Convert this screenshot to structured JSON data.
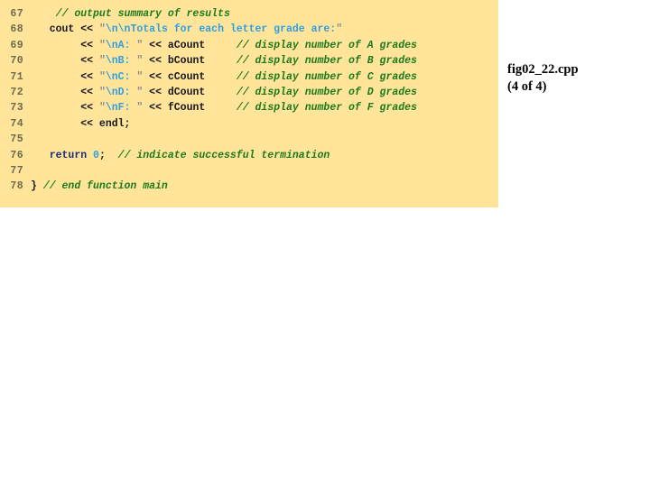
{
  "code_panel": {
    "background_color": "#ffe49a",
    "lineno_color": "#6e6a4c",
    "language": "cpp",
    "first_line_number": 67,
    "last_line_number": 78,
    "lines": [
      {
        "number": "67",
        "text": "    // output summary of results",
        "tokens": [
          {
            "t": "    ",
            "c": "plain"
          },
          {
            "t": "// output summary of results",
            "c": "comment"
          }
        ]
      },
      {
        "number": "68",
        "text": "   cout << \"\\n\\nTotals for each letter grade are:\"",
        "tokens": [
          {
            "t": "   ",
            "c": "plain"
          },
          {
            "t": "cout",
            "c": "plain"
          },
          {
            "t": " << ",
            "c": "plain"
          },
          {
            "t": "\"",
            "c": "quote"
          },
          {
            "t": "\\n\\nTotals for each letter grade are:",
            "c": "str"
          },
          {
            "t": "\"",
            "c": "quote"
          }
        ]
      },
      {
        "number": "69",
        "text": "        << \"\\nA: \" << aCount     // display number of A grades",
        "tokens": [
          {
            "t": "        ",
            "c": "plain"
          },
          {
            "t": "<< ",
            "c": "plain"
          },
          {
            "t": "\"",
            "c": "quote"
          },
          {
            "t": "\\nA: ",
            "c": "str"
          },
          {
            "t": "\"",
            "c": "quote"
          },
          {
            "t": " << ",
            "c": "plain"
          },
          {
            "t": "aCount",
            "c": "plain"
          },
          {
            "t": "     ",
            "c": "plain"
          },
          {
            "t": "// display number of A grades",
            "c": "comment"
          }
        ]
      },
      {
        "number": "70",
        "text": "        << \"\\nB: \" << bCount     // display number of B grades",
        "tokens": [
          {
            "t": "        ",
            "c": "plain"
          },
          {
            "t": "<< ",
            "c": "plain"
          },
          {
            "t": "\"",
            "c": "quote"
          },
          {
            "t": "\\nB: ",
            "c": "str"
          },
          {
            "t": "\"",
            "c": "quote"
          },
          {
            "t": " << ",
            "c": "plain"
          },
          {
            "t": "bCount",
            "c": "plain"
          },
          {
            "t": "     ",
            "c": "plain"
          },
          {
            "t": "// display number of B grades",
            "c": "comment"
          }
        ]
      },
      {
        "number": "71",
        "text": "        << \"\\nC: \" << cCount     // display number of C grades",
        "tokens": [
          {
            "t": "        ",
            "c": "plain"
          },
          {
            "t": "<< ",
            "c": "plain"
          },
          {
            "t": "\"",
            "c": "quote"
          },
          {
            "t": "\\nC: ",
            "c": "str"
          },
          {
            "t": "\"",
            "c": "quote"
          },
          {
            "t": " << ",
            "c": "plain"
          },
          {
            "t": "cCount",
            "c": "plain"
          },
          {
            "t": "     ",
            "c": "plain"
          },
          {
            "t": "// display number of C grades",
            "c": "comment"
          }
        ]
      },
      {
        "number": "72",
        "text": "        << \"\\nD: \" << dCount     // display number of D grades",
        "tokens": [
          {
            "t": "        ",
            "c": "plain"
          },
          {
            "t": "<< ",
            "c": "plain"
          },
          {
            "t": "\"",
            "c": "quote"
          },
          {
            "t": "\\nD: ",
            "c": "str"
          },
          {
            "t": "\"",
            "c": "quote"
          },
          {
            "t": " << ",
            "c": "plain"
          },
          {
            "t": "dCount",
            "c": "plain"
          },
          {
            "t": "     ",
            "c": "plain"
          },
          {
            "t": "// display number of D grades",
            "c": "comment"
          }
        ]
      },
      {
        "number": "73",
        "text": "        << \"\\nF: \" << fCount     // display number of F grades",
        "tokens": [
          {
            "t": "        ",
            "c": "plain"
          },
          {
            "t": "<< ",
            "c": "plain"
          },
          {
            "t": "\"",
            "c": "quote"
          },
          {
            "t": "\\nF: ",
            "c": "str"
          },
          {
            "t": "\"",
            "c": "quote"
          },
          {
            "t": " << ",
            "c": "plain"
          },
          {
            "t": "fCount",
            "c": "plain"
          },
          {
            "t": "     ",
            "c": "plain"
          },
          {
            "t": "// display number of F grades",
            "c": "comment"
          }
        ]
      },
      {
        "number": "74",
        "text": "        << endl;",
        "tokens": [
          {
            "t": "        ",
            "c": "plain"
          },
          {
            "t": "<< endl;",
            "c": "plain"
          }
        ]
      },
      {
        "number": "75",
        "text": "",
        "tokens": []
      },
      {
        "number": "76",
        "text": "   return 0;  // indicate successful termination",
        "tokens": [
          {
            "t": "   ",
            "c": "plain"
          },
          {
            "t": "return",
            "c": "kw"
          },
          {
            "t": " ",
            "c": "plain"
          },
          {
            "t": "0",
            "c": "num"
          },
          {
            "t": ";",
            "c": "plain"
          },
          {
            "t": "  ",
            "c": "plain"
          },
          {
            "t": "// indicate successful termination",
            "c": "comment"
          }
        ]
      },
      {
        "number": "77",
        "text": "",
        "tokens": []
      },
      {
        "number": "78",
        "text": "} // end function main",
        "tokens": [
          {
            "t": "}",
            "c": "plain"
          },
          {
            "t": " ",
            "c": "plain"
          },
          {
            "t": "// end function main",
            "c": "comment"
          }
        ]
      }
    ]
  },
  "caption": {
    "filename": "fig02_22.cpp",
    "part": "(4 of 4)"
  }
}
